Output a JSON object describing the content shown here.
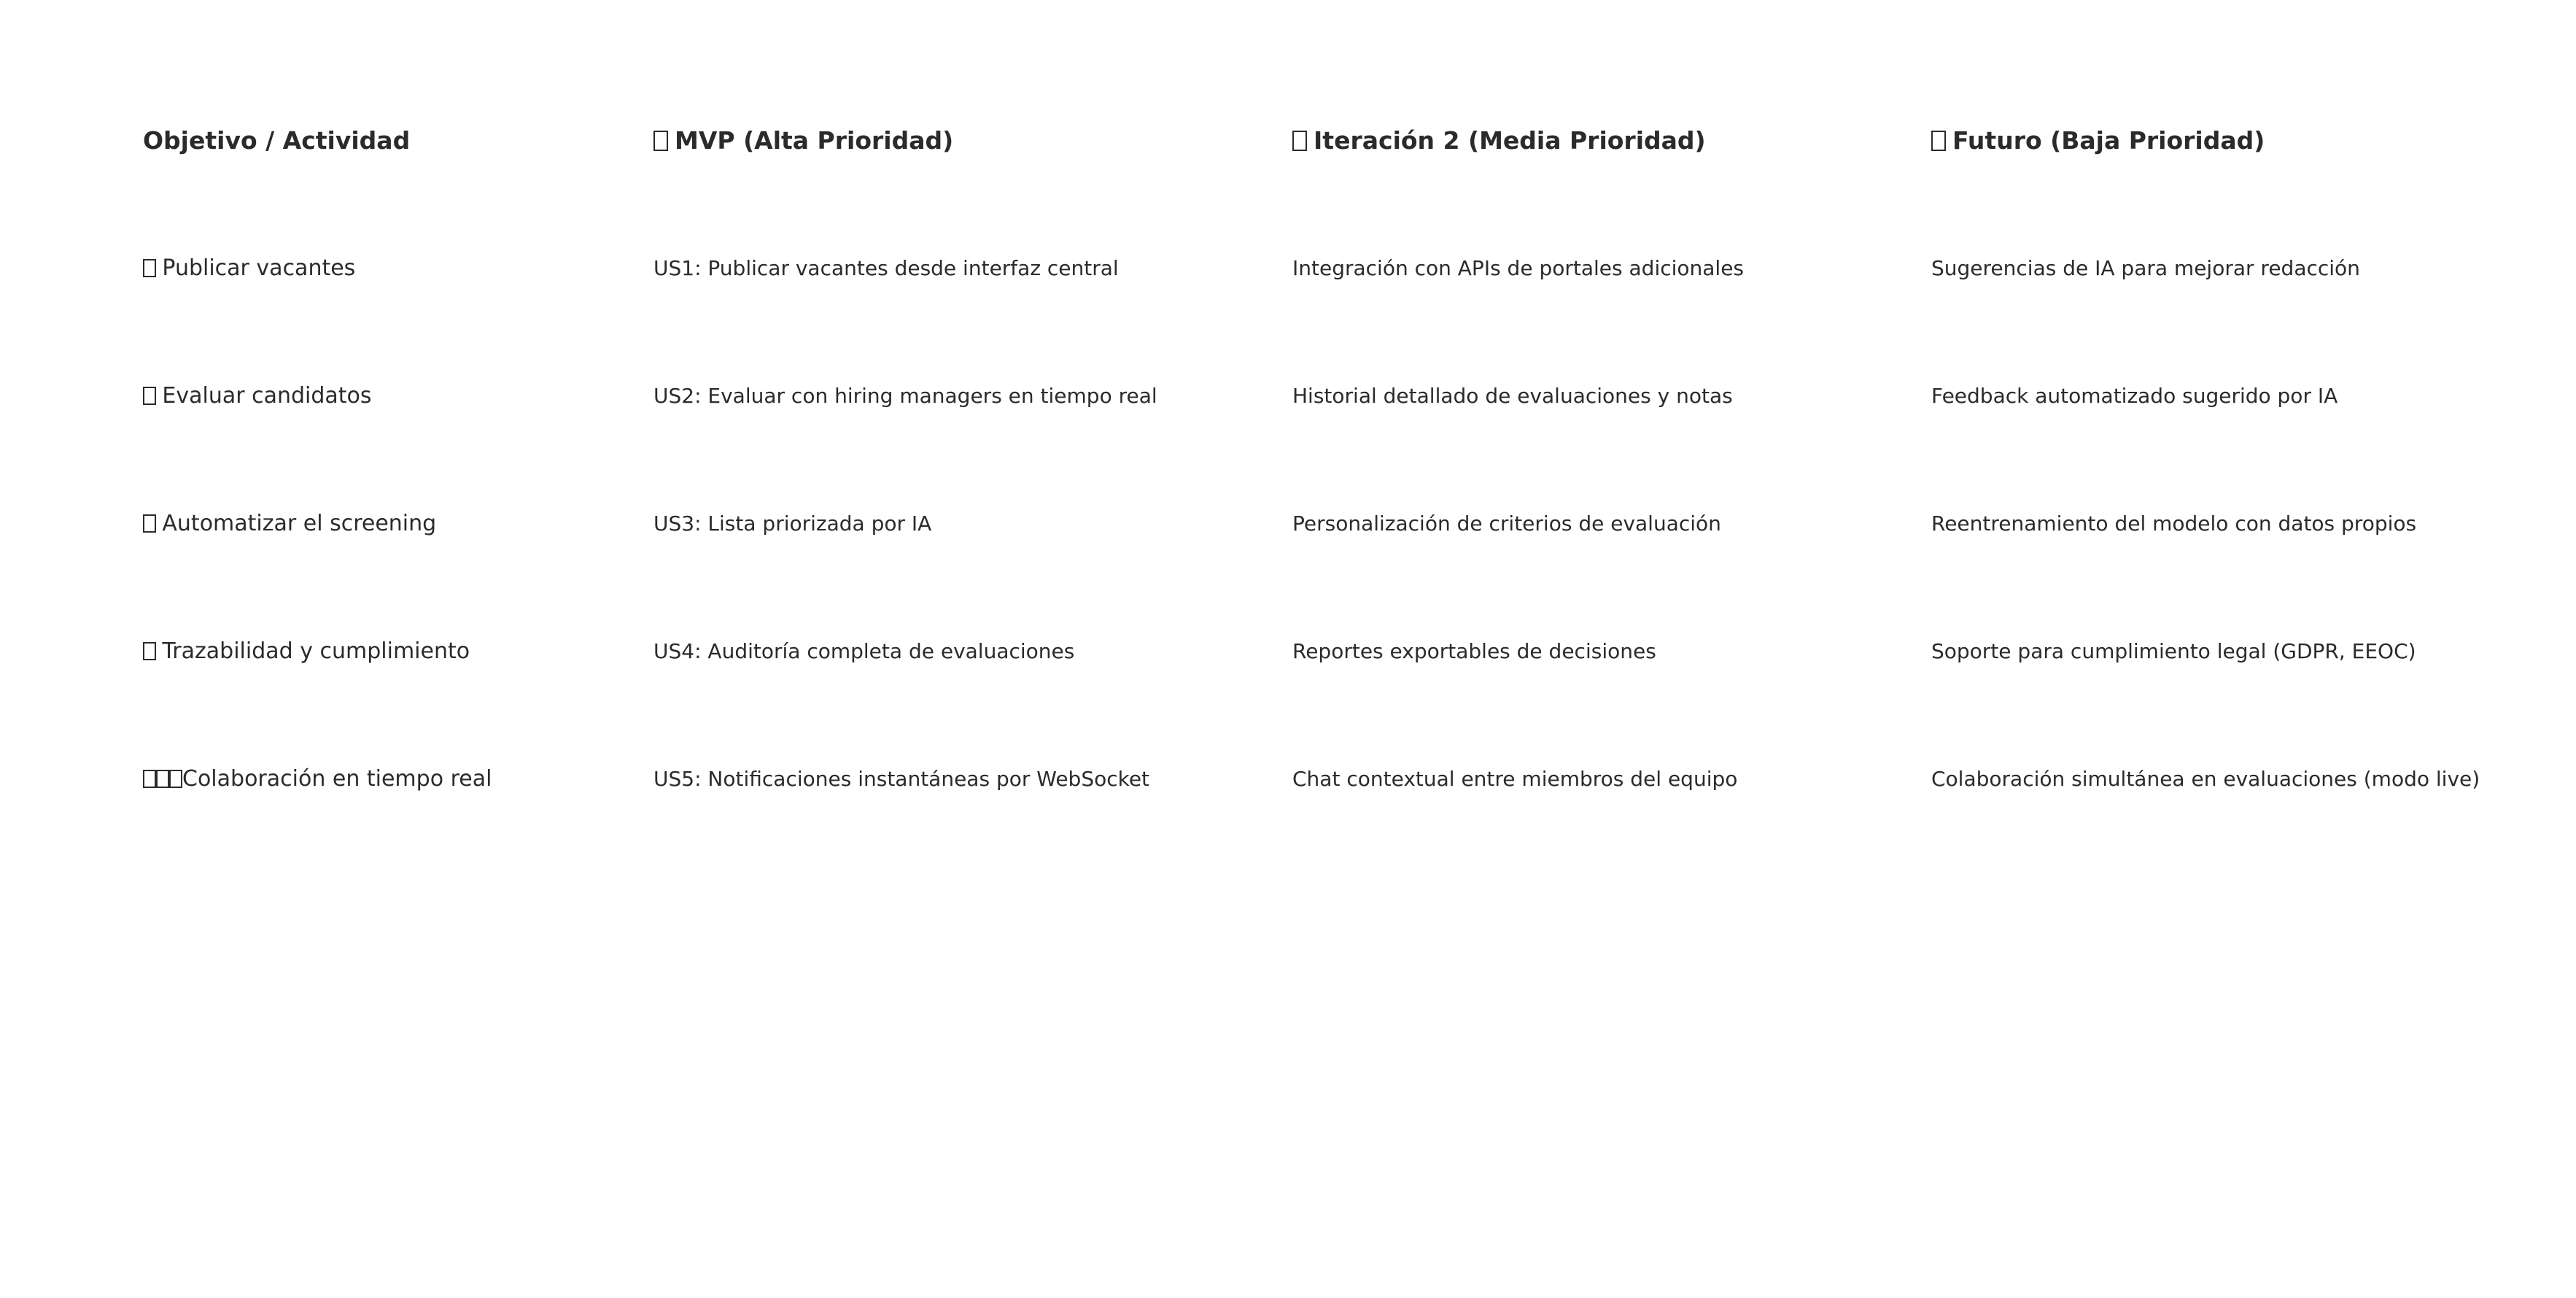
{
  "header": {
    "objective": "Objetivo / Actividad",
    "mvp": "MVP (Alta Prioridad)",
    "iteration2": "Iteración 2 (Media Prioridad)",
    "future": "Futuro (Baja Prioridad)"
  },
  "rows": [
    {
      "activity": "Publicar vacantes",
      "mvp": "US1: Publicar vacantes desde interfaz central",
      "iteration2": "Integración con APIs de portales adicionales",
      "future": "Sugerencias de IA para mejorar redacción"
    },
    {
      "activity": "Evaluar candidatos",
      "mvp": "US2: Evaluar con hiring managers en tiempo real",
      "iteration2": "Historial detallado de evaluaciones y notas",
      "future": "Feedback automatizado sugerido por IA"
    },
    {
      "activity": "Automatizar el screening",
      "mvp": "US3: Lista priorizada por IA",
      "iteration2": "Personalización de criterios de evaluación",
      "future": "Reentrenamiento del modelo con datos propios"
    },
    {
      "activity": "Trazabilidad y cumplimiento",
      "mvp": "US4: Auditoría completa de evaluaciones",
      "iteration2": "Reportes exportables de decisiones",
      "future": "Soporte para cumplimiento legal (GDPR, EEOC)"
    },
    {
      "activity": "Colaboración en tiempo real",
      "mvp": "US5: Notificaciones instantáneas por WebSocket",
      "iteration2": "Chat contextual entre miembros del equipo",
      "future": "Colaboración simultánea en evaluaciones (modo live)"
    }
  ]
}
